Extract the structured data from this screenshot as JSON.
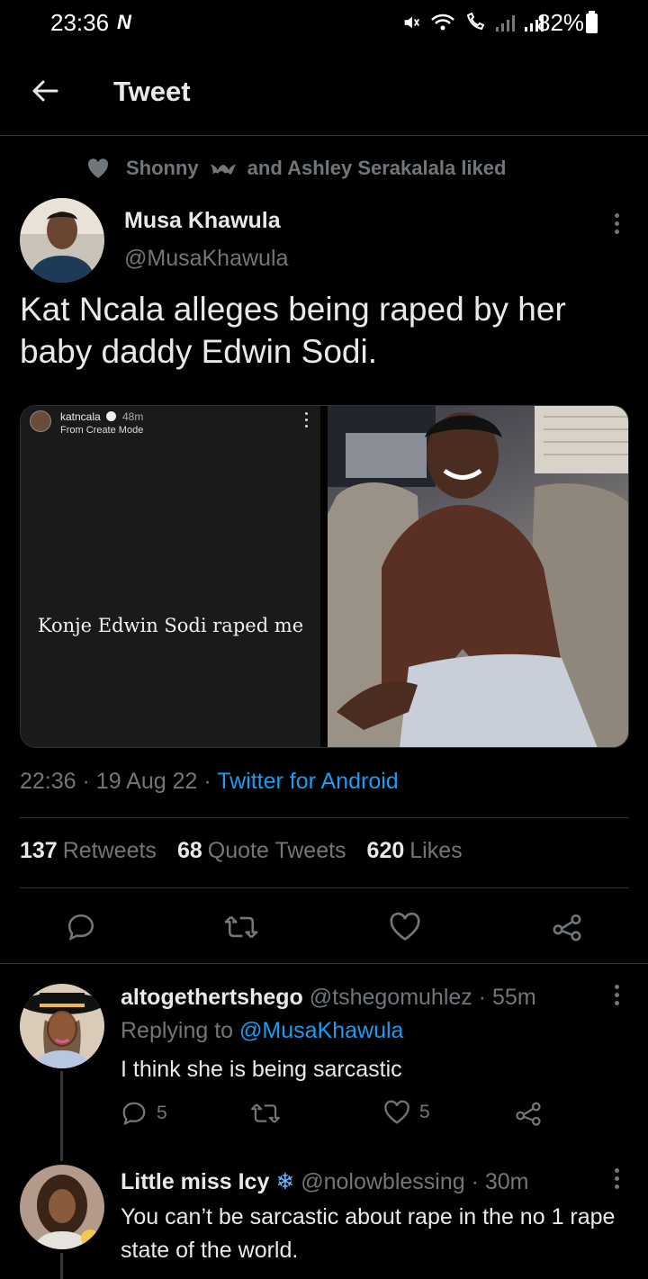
{
  "status_bar": {
    "time": "23:36",
    "carrier_mark": "N",
    "battery": "82%"
  },
  "header": {
    "title": "Tweet"
  },
  "liked_banner": {
    "text_a": "Shonny",
    "text_b": "and Ashley Serakalala liked"
  },
  "tweet": {
    "author_name": "Musa Khawula",
    "author_handle": "@MusaKhawula",
    "text": "Kat Ncala alleges being raped by her baby daddy Edwin Sodi.",
    "media_left": {
      "username": "katncala",
      "time": "48m",
      "subtitle": "From Create Mode",
      "caption": "Konje Edwin Sodi raped me"
    },
    "time": "22:36",
    "date": "19 Aug 22",
    "source": "Twitter for Android",
    "retweets_count": "137",
    "retweets_label": "Retweets",
    "quotes_count": "68",
    "quotes_label": "Quote Tweets",
    "likes_count": "620",
    "likes_label": "Likes"
  },
  "replies": [
    {
      "name": "altogethertshego",
      "handle": "@tshegomuhlez",
      "time": "55m",
      "replying_prefix": "Replying to",
      "replying_handle": "@MusaKhawula",
      "text": "I think she is being sarcastic",
      "reply_count": "5",
      "like_count": "5"
    },
    {
      "name": "Little miss Icy",
      "emoji": "❄",
      "handle": "@nolowblessing",
      "time": "30m",
      "text": "You can’t be sarcastic about rape in the no 1 rape state of the world."
    }
  ],
  "colors": {
    "background": "#000000",
    "text": "#e7e9ea",
    "muted": "#71767b",
    "accent": "#1d9bf0",
    "divider": "#2f3336"
  }
}
